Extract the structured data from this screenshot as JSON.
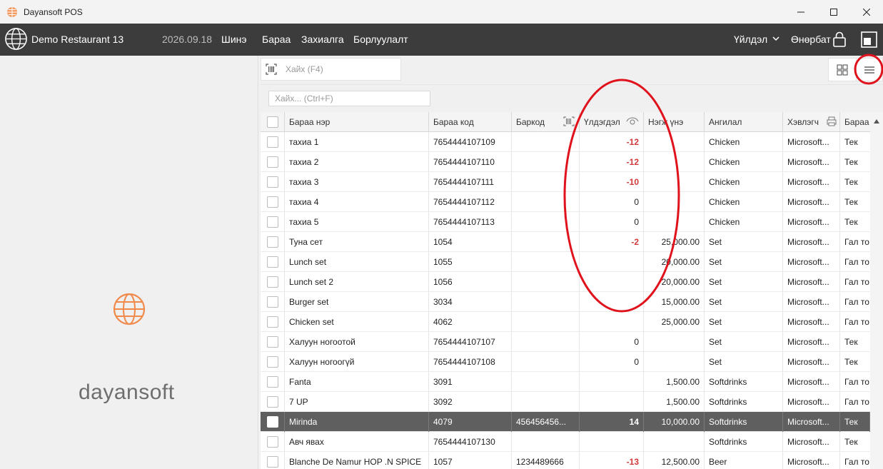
{
  "window": {
    "title": "Dayansoft POS"
  },
  "appbar": {
    "restaurant": "Demo Restaurant 13",
    "date": "2026.09.18",
    "nav": [
      "Шинэ",
      "Бараа",
      "Захиалга",
      "Борлуулалт"
    ],
    "user_menu": "Үйлдэл",
    "lock_label": "Өнөрбат"
  },
  "brand": {
    "name": "dayansoft"
  },
  "search": {
    "placeholder": "Хайх (F4)"
  },
  "filter": {
    "placeholder": "Хайх... (Ctrl+F)"
  },
  "columns": [
    "Бараа нэр",
    "Бараа код",
    "Баркод",
    "Үлдэгдэл",
    "Нэгж үнэ",
    "Ангилал",
    "Хэвлэгч",
    "Бараа"
  ],
  "rows": [
    {
      "name": "тахиа 1",
      "code": "7654444107109",
      "barcode": "",
      "stock": "-12",
      "price": "",
      "category": "Chicken",
      "printer": "Microsoft...",
      "type": "Тек"
    },
    {
      "name": "тахиа 2",
      "code": "7654444107110",
      "barcode": "",
      "stock": "-12",
      "price": "",
      "category": "Chicken",
      "printer": "Microsoft...",
      "type": "Тек"
    },
    {
      "name": "тахиа 3",
      "code": "7654444107111",
      "barcode": "",
      "stock": "-10",
      "price": "",
      "category": "Chicken",
      "printer": "Microsoft...",
      "type": "Тек"
    },
    {
      "name": "тахиа 4",
      "code": "7654444107112",
      "barcode": "",
      "stock": "0",
      "price": "",
      "category": "Chicken",
      "printer": "Microsoft...",
      "type": "Тек"
    },
    {
      "name": "тахиа 5",
      "code": "7654444107113",
      "barcode": "",
      "stock": "0",
      "price": "",
      "category": "Chicken",
      "printer": "Microsoft...",
      "type": "Тек"
    },
    {
      "name": "Туна сет",
      "code": "1054",
      "barcode": "",
      "stock": "-2",
      "price": "25,000.00",
      "category": "Set",
      "printer": "Microsoft...",
      "type": "Гал то"
    },
    {
      "name": "Lunch set",
      "code": "1055",
      "barcode": "",
      "stock": "",
      "price": "20,000.00",
      "category": "Set",
      "printer": "Microsoft...",
      "type": "Гал то"
    },
    {
      "name": "Lunch set 2",
      "code": "1056",
      "barcode": "",
      "stock": "",
      "price": "20,000.00",
      "category": "Set",
      "printer": "Microsoft...",
      "type": "Гал то"
    },
    {
      "name": "Burger set",
      "code": "3034",
      "barcode": "",
      "stock": "",
      "price": "15,000.00",
      "category": "Set",
      "printer": "Microsoft...",
      "type": "Гал то"
    },
    {
      "name": "Chicken set",
      "code": "4062",
      "barcode": "",
      "stock": "",
      "price": "25,000.00",
      "category": "Set",
      "printer": "Microsoft...",
      "type": "Гал то"
    },
    {
      "name": "Халуун ногоотой",
      "code": "7654444107107",
      "barcode": "",
      "stock": "0",
      "price": "",
      "category": "Set",
      "printer": "Microsoft...",
      "type": "Тек"
    },
    {
      "name": "Халуун ногоогүй",
      "code": "7654444107108",
      "barcode": "",
      "stock": "0",
      "price": "",
      "category": "Set",
      "printer": "Microsoft...",
      "type": "Тек"
    },
    {
      "name": "Fanta",
      "code": "3091",
      "barcode": "",
      "stock": "",
      "price": "1,500.00",
      "category": "Softdrinks",
      "printer": "Microsoft...",
      "type": "Гал то"
    },
    {
      "name": "7 UP",
      "code": "3092",
      "barcode": "",
      "stock": "",
      "price": "1,500.00",
      "category": "Softdrinks",
      "printer": "Microsoft...",
      "type": "Гал то"
    },
    {
      "name": "Mirinda",
      "code": "4079",
      "barcode": "456456456...",
      "stock": "14",
      "price": "10,000.00",
      "category": "Softdrinks",
      "printer": "Microsoft...",
      "type": "Тек",
      "selected": true
    },
    {
      "name": "Авч явах",
      "code": "7654444107130",
      "barcode": "",
      "stock": "",
      "price": "",
      "category": "Softdrinks",
      "printer": "Microsoft...",
      "type": "Тек"
    },
    {
      "name": "Blanche De Namur HOP .N SPICE",
      "code": "1057",
      "barcode": "1234489666",
      "stock": "-13",
      "price": "12,500.00",
      "category": "Beer",
      "printer": "Microsoft...",
      "type": "Гал то"
    }
  ],
  "colors": {
    "accent": "#3c3c3c",
    "negative": "#d23a3a",
    "brand": "#f08a4b",
    "annotation": "#e0121c"
  }
}
